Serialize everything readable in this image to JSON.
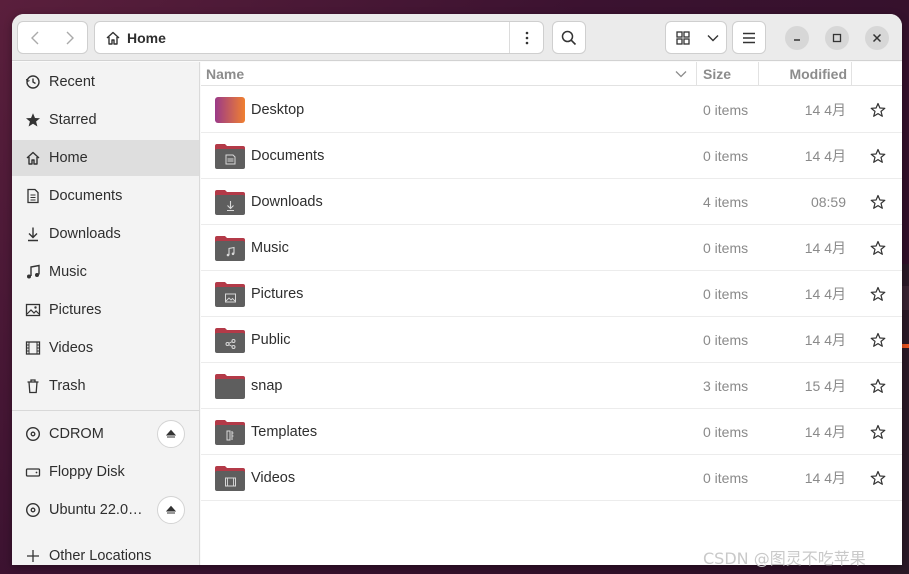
{
  "colors": {
    "accent": "#e95420",
    "folder_dark": "#5e5e5e",
    "folder_tab": "#b33a48",
    "desktop_start": "#9b3a88",
    "desktop_end": "#f08030"
  },
  "header": {
    "path_label": "Home",
    "icons": [
      "back-icon",
      "forward-icon",
      "home-icon",
      "more-vertical-icon",
      "search-icon",
      "grid-view-icon",
      "chevron-down-icon",
      "hamburger-menu-icon",
      "minimize-icon",
      "maximize-icon",
      "close-icon"
    ]
  },
  "sidebar": {
    "items": [
      {
        "label": "Recent",
        "icon": "clock-icon"
      },
      {
        "label": "Starred",
        "icon": "star-icon"
      },
      {
        "label": "Home",
        "icon": "home-icon",
        "active": true
      },
      {
        "label": "Documents",
        "icon": "document-icon"
      },
      {
        "label": "Downloads",
        "icon": "download-icon"
      },
      {
        "label": "Music",
        "icon": "music-icon"
      },
      {
        "label": "Pictures",
        "icon": "picture-icon"
      },
      {
        "label": "Videos",
        "icon": "video-icon"
      },
      {
        "label": "Trash",
        "icon": "trash-icon"
      }
    ],
    "devices": [
      {
        "label": "CDROM",
        "icon": "disc-icon",
        "ejectable": true
      },
      {
        "label": "Floppy Disk",
        "icon": "drive-icon",
        "ejectable": false
      },
      {
        "label": "Ubuntu 22.0…",
        "icon": "disc-icon",
        "ejectable": true
      }
    ],
    "other": {
      "label": "Other Locations",
      "icon": "plus-icon"
    }
  },
  "columns": {
    "name": "Name",
    "size": "Size",
    "modified": "Modified"
  },
  "files": [
    {
      "name": "Desktop",
      "size": "0 items",
      "modified": "14 4月",
      "icon": "desktop-folder-icon"
    },
    {
      "name": "Documents",
      "size": "0 items",
      "modified": "14 4月",
      "icon": "documents-folder-icon"
    },
    {
      "name": "Downloads",
      "size": "4 items",
      "modified": "08:59",
      "icon": "downloads-folder-icon"
    },
    {
      "name": "Music",
      "size": "0 items",
      "modified": "14 4月",
      "icon": "music-folder-icon"
    },
    {
      "name": "Pictures",
      "size": "0 items",
      "modified": "14 4月",
      "icon": "pictures-folder-icon"
    },
    {
      "name": "Public",
      "size": "0 items",
      "modified": "14 4月",
      "icon": "public-folder-icon"
    },
    {
      "name": "snap",
      "size": "3 items",
      "modified": "15 4月",
      "icon": "folder-icon"
    },
    {
      "name": "Templates",
      "size": "0 items",
      "modified": "14 4月",
      "icon": "templates-folder-icon"
    },
    {
      "name": "Videos",
      "size": "0 items",
      "modified": "14 4月",
      "icon": "videos-folder-icon"
    }
  ],
  "watermark": "CSDN @图灵不吃苹果"
}
